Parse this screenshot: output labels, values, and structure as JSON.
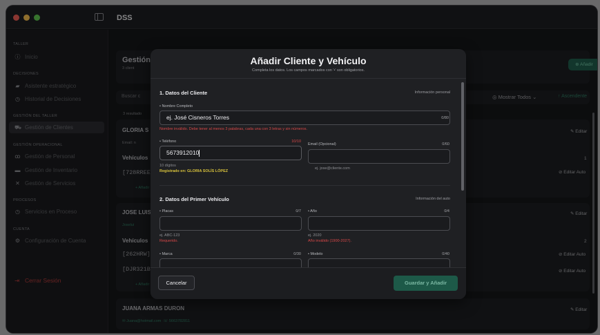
{
  "window": {
    "title": "DSS",
    "traffic_colors": [
      "#ee5d55",
      "#f4bd4e",
      "#5fc650"
    ]
  },
  "sidebar": {
    "sections": [
      {
        "title": "TALLER",
        "items": [
          {
            "label": "Inicio",
            "icon": "info-icon"
          }
        ]
      },
      {
        "title": "DECISIONES",
        "items": [
          {
            "label": "Asistente estratégico",
            "icon": "chat-icon"
          },
          {
            "label": "Historial de Decisiones",
            "icon": "clock-icon"
          }
        ]
      },
      {
        "title": "GESTIÓN DEL TALLER",
        "items": [
          {
            "label": "Gestión de Clientes",
            "icon": "car-icon",
            "active": true
          }
        ]
      },
      {
        "title": "GESTIÓN OPERACIONAL",
        "items": [
          {
            "label": "Gestión de Personal",
            "icon": "people-icon"
          },
          {
            "label": "Gestión de Inventario",
            "icon": "box-icon"
          },
          {
            "label": "Gestión de Servicios",
            "icon": "tools-icon"
          }
        ]
      },
      {
        "title": "PROCESOS",
        "items": [
          {
            "label": "Servicios en Proceso",
            "icon": "clock-icon"
          }
        ]
      },
      {
        "title": "CUENTA",
        "items": [
          {
            "label": "Configuración de Cuenta",
            "icon": "settings-icon"
          }
        ]
      }
    ],
    "logout_label": "Cerrar Sesión"
  },
  "background": {
    "page_title": "Gestión",
    "page_count": "3 client",
    "add_button": "Añadir",
    "search_placeholder": "Buscar c",
    "filter_label": "Mostrar Todos",
    "sort_label": "Ascendente",
    "results_label": "3 resultado",
    "clients": [
      {
        "name": "GLORIA S",
        "email": "Email: n",
        "vehicles_label": "Vehículos",
        "vehicles": [
          "[728RREE"
        ],
        "count": "1",
        "add_label": "+ Añadir"
      },
      {
        "name": "JOSE LUIS",
        "email": "Joselui",
        "vehicles_label": "Vehículos",
        "vehicles": [
          "[262HRW]",
          "[DJR321B"
        ],
        "count": "2",
        "add_label": "+ Añadir"
      },
      {
        "name": "JUANA ARMAS DURON",
        "email": "Juana@hotmail.com",
        "phone": "5663782811"
      }
    ],
    "edit_label": "Editar",
    "edit_auto_label": "Editar Auto"
  },
  "modal": {
    "title": "Añadir Cliente y Vehículo",
    "subtitle": "Completa los datos. Los campos marcados con '•' son obligatorios.",
    "client_section": {
      "title": "1. Datos del Cliente",
      "hint": "Información personal",
      "name_label": "• Nombre Completo",
      "name_value": "ej. José Cisneros Torres",
      "name_count": "0/80",
      "name_error": "Nombre inválido. Debe tener al menos 3 palabras, cada una con 3 letras y sin números.",
      "phone_label": "• Teléfono",
      "phone_value": "5673912010",
      "phone_count": "10/10",
      "phone_hint": "10 dígitos",
      "phone_warning": "Registrado en: GLORIA SOLÍS LÓPEZ",
      "email_label": "Email (Opcional)",
      "email_count": "0/60",
      "email_placeholder": "ej. jose@cliente.com"
    },
    "vehicle_section": {
      "title": "2. Datos del Primer Vehículo",
      "hint": "Información del auto",
      "plates_label": "• Placas",
      "plates_count": "0/7",
      "plates_placeholder": "ej. ABC-123",
      "plates_error": "Requerido.",
      "year_label": "• Año",
      "year_count": "0/4",
      "year_placeholder": "ej. 2020",
      "year_error": "Año inválido (1900-2027).",
      "brand_label": "• Marca",
      "brand_count": "0/30",
      "model_label": "• Modelo",
      "model_count": "0/40"
    },
    "cancel_label": "Cancelar",
    "save_label": "Guardar y Añadir"
  }
}
